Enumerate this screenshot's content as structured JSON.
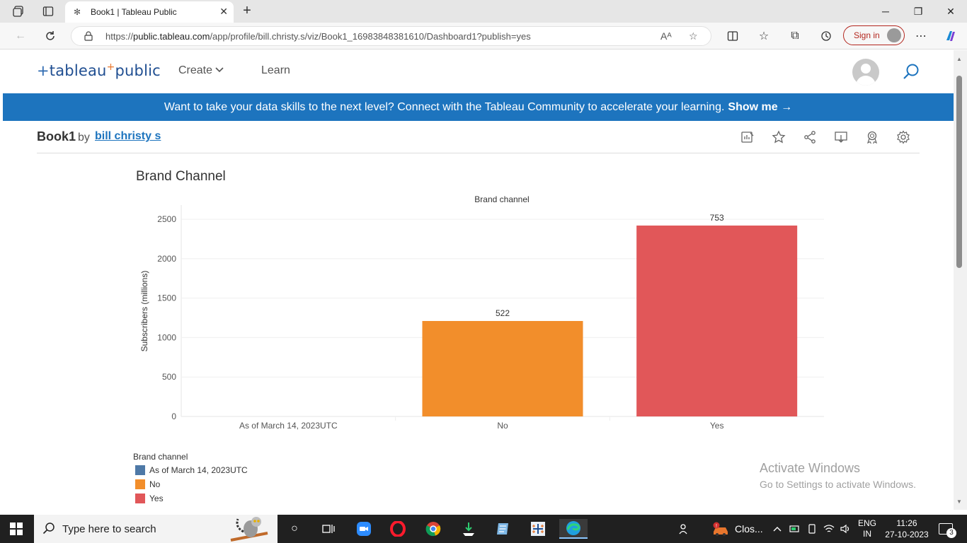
{
  "browser": {
    "tab_title": "Book1 | Tableau Public",
    "new_tab_symbol": "+",
    "url_prefix": "https://",
    "url_host": "public.tableau.com",
    "url_path": "/app/profile/bill.christy.s/viz/Book1_16983848381610/Dashboard1?publish=yes",
    "sign_in_label": "Sign in",
    "read_aloud_label": "Aᴬ"
  },
  "site": {
    "logo_text": "tableau",
    "logo_suffix": "public",
    "nav": {
      "create_label": "Create",
      "learn_label": "Learn"
    },
    "banner": {
      "text": "Want to take your data skills to the next level? Connect with the Tableau Community to accelerate your learning.",
      "link_label": "Show me →"
    },
    "workbook": {
      "title": "Book1",
      "by_label": "by",
      "author": "bill christy s"
    }
  },
  "viz": {
    "title": "Brand Channel",
    "legend_title": "Brand channel",
    "colors": {
      "As of March 14, 2023UTC": "#4e79a7",
      "No": "#f28e2b",
      "Yes": "#e15759"
    }
  },
  "chart_data": {
    "type": "bar",
    "title": "Brand channel",
    "xlabel": "",
    "ylabel": "Subscribers (millions)",
    "categories": [
      "As of March 14, 2023UTC",
      "No",
      "Yes"
    ],
    "values": [
      0,
      1210,
      2420
    ],
    "data_labels": [
      "",
      "522",
      "753"
    ],
    "y_ticks": [
      0,
      500,
      1000,
      1500,
      2000,
      2500
    ],
    "ylim": [
      0,
      2680
    ],
    "grid": true,
    "legend_position": "bottom-left"
  },
  "watermark": {
    "line1": "Activate Windows",
    "line2": "Go to Settings to activate Windows."
  },
  "taskbar": {
    "search_placeholder": "Type here to search",
    "tray_app_label": "Clos...",
    "language_line1": "ENG",
    "language_line2": "IN",
    "time": "11:26",
    "date": "27-10-2023",
    "notification_count": "3"
  }
}
